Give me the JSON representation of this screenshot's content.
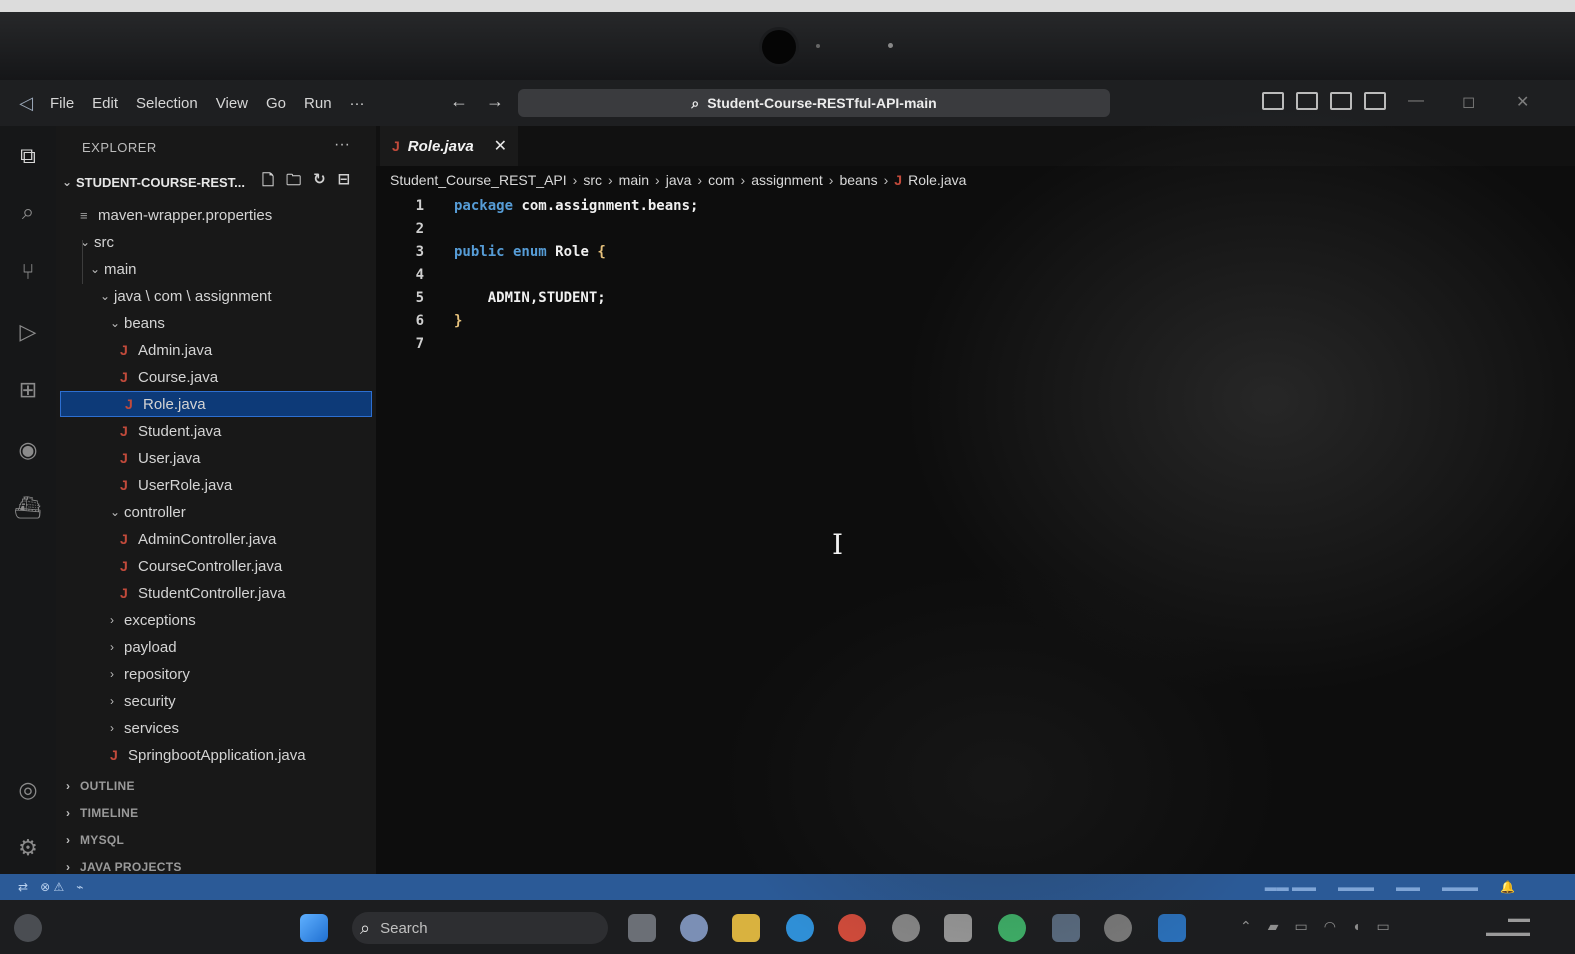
{
  "window": {
    "menu": [
      "File",
      "Edit",
      "Selection",
      "View",
      "Go",
      "Run",
      "···"
    ],
    "command_center": "Student-Course-RESTful-API-main"
  },
  "explorer": {
    "title": "EXPLORER",
    "more": "···",
    "project": "STUDENT-COURSE-REST...",
    "items": [
      {
        "label": "maven-wrapper.properties",
        "kind": "file",
        "depth": 1
      },
      {
        "label": "src",
        "kind": "folder-open",
        "depth": 1
      },
      {
        "label": "main",
        "kind": "folder-open",
        "depth": 2
      },
      {
        "label": "java \\ com \\ assignment",
        "kind": "folder-open",
        "depth": 3
      },
      {
        "label": "beans",
        "kind": "folder-open",
        "depth": 4
      },
      {
        "label": "Admin.java",
        "kind": "java",
        "depth": 5
      },
      {
        "label": "Course.java",
        "kind": "java",
        "depth": 5
      },
      {
        "label": "Role.java",
        "kind": "java",
        "depth": 5,
        "selected": true
      },
      {
        "label": "Student.java",
        "kind": "java",
        "depth": 5
      },
      {
        "label": "User.java",
        "kind": "java",
        "depth": 5
      },
      {
        "label": "UserRole.java",
        "kind": "java",
        "depth": 5
      },
      {
        "label": "controller",
        "kind": "folder-open",
        "depth": 4
      },
      {
        "label": "AdminController.java",
        "kind": "java",
        "depth": 5
      },
      {
        "label": "CourseController.java",
        "kind": "java",
        "depth": 5
      },
      {
        "label": "StudentController.java",
        "kind": "java",
        "depth": 5
      },
      {
        "label": "exceptions",
        "kind": "folder",
        "depth": 4
      },
      {
        "label": "payload",
        "kind": "folder",
        "depth": 4
      },
      {
        "label": "repository",
        "kind": "folder",
        "depth": 4
      },
      {
        "label": "security",
        "kind": "folder",
        "depth": 4
      },
      {
        "label": "services",
        "kind": "folder",
        "depth": 4
      },
      {
        "label": "SpringbootApplication.java",
        "kind": "java",
        "depth": 4
      }
    ],
    "sections": [
      "OUTLINE",
      "TIMELINE",
      "MYSQL",
      "JAVA PROJECTS"
    ]
  },
  "editor": {
    "tab_label": "Role.java",
    "breadcrumb": [
      "Student_Course_REST_API",
      "src",
      "main",
      "java",
      "com",
      "assignment",
      "beans",
      "Role.java"
    ],
    "lines": [
      {
        "n": "1",
        "parts": [
          [
            "kw",
            "package "
          ],
          [
            "pk",
            "com.assignment.beans;"
          ]
        ]
      },
      {
        "n": "2",
        "parts": []
      },
      {
        "n": "3",
        "parts": [
          [
            "kw",
            "public enum "
          ],
          [
            "pk",
            "Role "
          ],
          [
            "brace",
            "{"
          ]
        ]
      },
      {
        "n": "4",
        "parts": []
      },
      {
        "n": "5",
        "parts": [
          [
            "pk",
            "    ADMIN,STUDENT;"
          ]
        ]
      },
      {
        "n": "6",
        "parts": [
          [
            "brace",
            "}"
          ]
        ]
      },
      {
        "n": "7",
        "parts": []
      }
    ]
  },
  "taskbar": {
    "search_placeholder": "Search"
  }
}
